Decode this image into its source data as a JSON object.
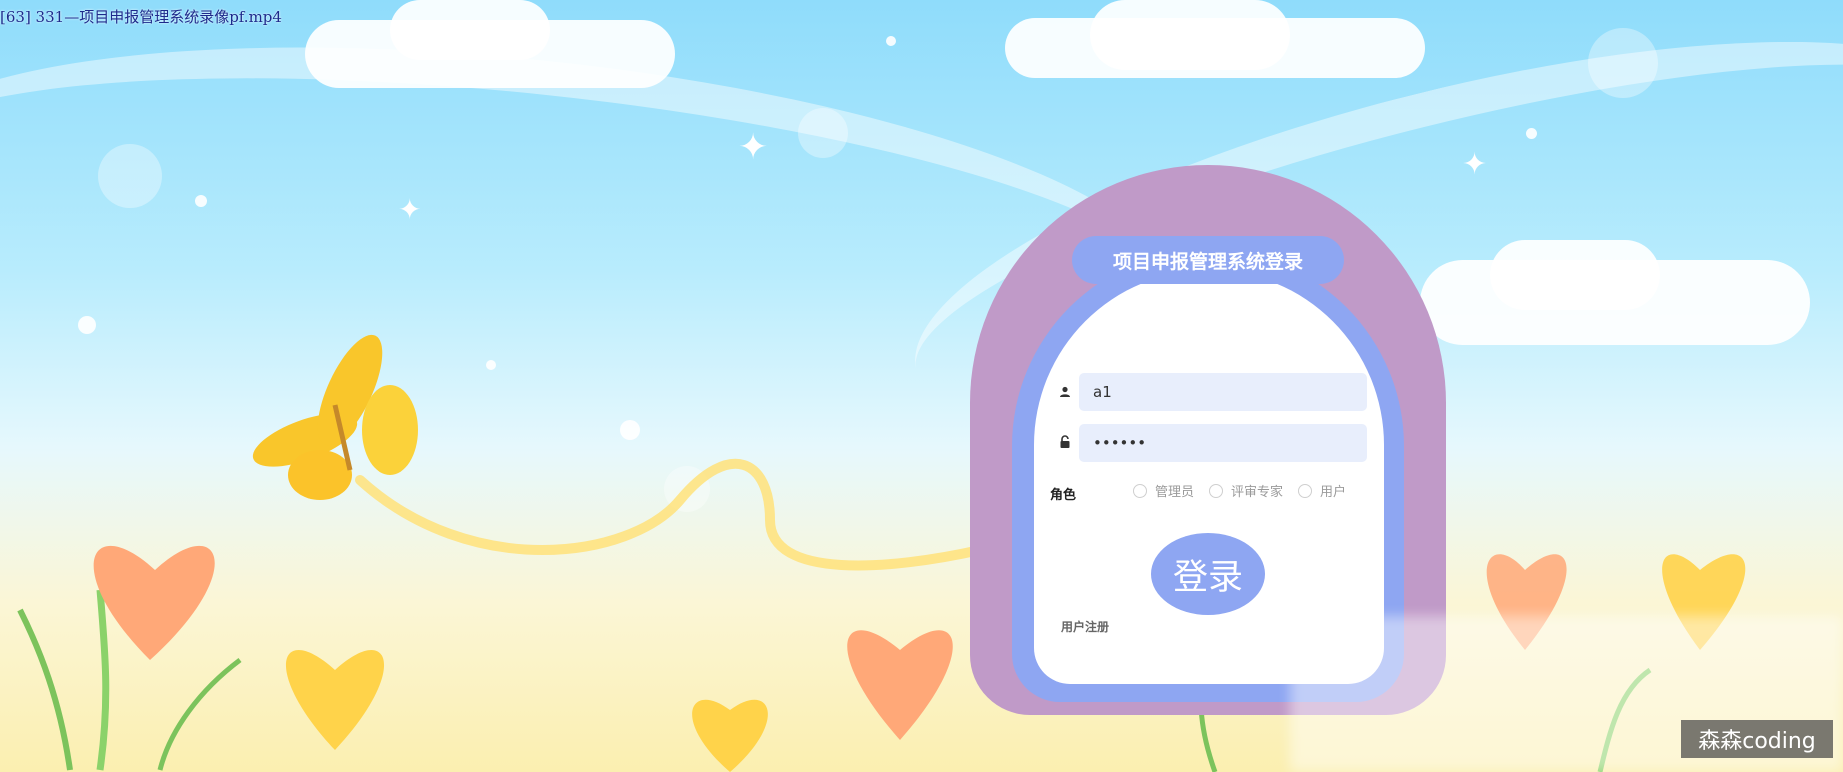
{
  "video_title": "[63] 331—项目申报管理系统录像pf.mp4",
  "login": {
    "title": "项目申报管理系统登录",
    "username_value": "a1",
    "password_value": "••••••",
    "role_label": "角色",
    "roles": [
      "管理员",
      "评审专家",
      "用户"
    ],
    "login_button": "登录",
    "register_link": "用户注册"
  },
  "watermark": "森森coding",
  "colors": {
    "card_outer": "#c09ac8",
    "card_accent": "#8ea6f2",
    "input_bg": "#e8eefc"
  },
  "icons": [
    "user-icon",
    "lock-icon"
  ]
}
